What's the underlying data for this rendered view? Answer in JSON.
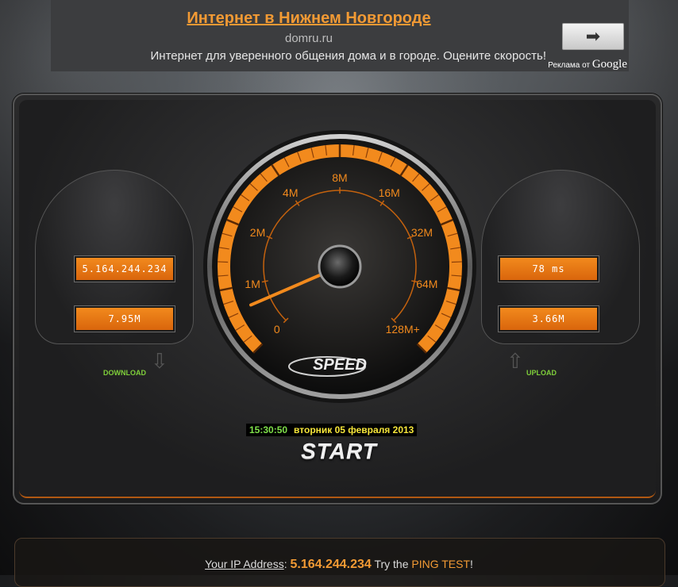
{
  "ad": {
    "title": "Интернет в Нижнем Новгороде",
    "url": "domru.ru",
    "description": "Интернет для уверенного общения дома и в городе. Оцените скорость!",
    "arrow": "➡",
    "ads_label": "Реклама от",
    "google": "Google"
  },
  "left": {
    "ip": "5.164.244.234",
    "download_speed": "7.95M",
    "download_label": "DOWNLOAD"
  },
  "right": {
    "ping": "78 ms",
    "upload_speed": "3.66M",
    "upload_label": "UPLOAD"
  },
  "gauge": {
    "scale_labels": [
      "0",
      "1M",
      "2M",
      "4M",
      "8M",
      "16M",
      "32M",
      "64M",
      "128M+"
    ],
    "logo": "SPEED",
    "needle_value": 0.08,
    "accent": "#f28a1d"
  },
  "clock": {
    "time": "15:30:50",
    "date": "вторник 05 февраля 2013"
  },
  "start_label": "START",
  "footer": {
    "your_ip_label": "Your IP Address",
    "ip": "5.164.244.234",
    "try_the": "Try the",
    "ping_test": "PING TEST",
    "excl": "!"
  }
}
